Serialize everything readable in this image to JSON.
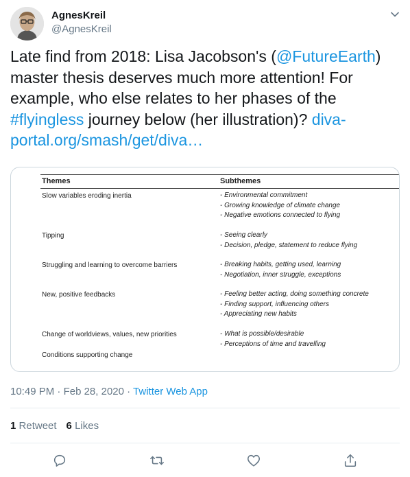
{
  "user": {
    "display_name": "AgnesKreil",
    "handle": "@AgnesKreil"
  },
  "tweet": {
    "text_parts": [
      "Late find from 2018: Lisa Jacobson's (",
      "@FutureEarth",
      ") master thesis deserves much more attention! For example, who else relates to her phases of the ",
      "#flyingless",
      " journey below (her illustration)? ",
      "diva-portal.org/smash/get/diva…"
    ]
  },
  "media_table": {
    "header": {
      "themes": "Themes",
      "subthemes": "Subthemes"
    },
    "rows": [
      {
        "theme": "Slow variables eroding inertia",
        "subthemes": [
          "- Environmental commitment",
          "- Growing knowledge of climate change",
          "- Negative emotions connected to flying"
        ]
      },
      {
        "theme": "Tipping",
        "subthemes": [
          "- Seeing clearly",
          "- Decision, pledge, statement to reduce flying"
        ]
      },
      {
        "theme": "Struggling and learning to overcome barriers",
        "subthemes": [
          "- Breaking habits, getting used, learning",
          "- Negotiation, inner struggle, exceptions"
        ]
      },
      {
        "theme": "New, positive feedbacks",
        "subthemes": [
          "- Feeling better acting, doing something concrete",
          "- Finding support, influencing others",
          "- Appreciating new habits"
        ]
      },
      {
        "theme": "Change of worldviews, values, new priorities",
        "subthemes": [
          "- What is possible/desirable",
          "- Perceptions of time and travelling"
        ]
      },
      {
        "theme": "Conditions supporting change",
        "subthemes": []
      }
    ]
  },
  "meta": {
    "time": "10:49 PM",
    "sep": " · ",
    "date": "Feb 28, 2020",
    "app": "Twitter Web App"
  },
  "stats": {
    "retweets_count": "1",
    "retweets_label": "Retweet",
    "likes_count": "6",
    "likes_label": "Likes"
  },
  "icons": {
    "reply": "reply-icon",
    "retweet": "retweet-icon",
    "like": "heart-icon",
    "share": "share-icon",
    "caret": "chevron-down-icon"
  },
  "colors": {
    "link": "#1b95e0",
    "secondary_text": "#657786",
    "border": "#e6ecf0"
  }
}
